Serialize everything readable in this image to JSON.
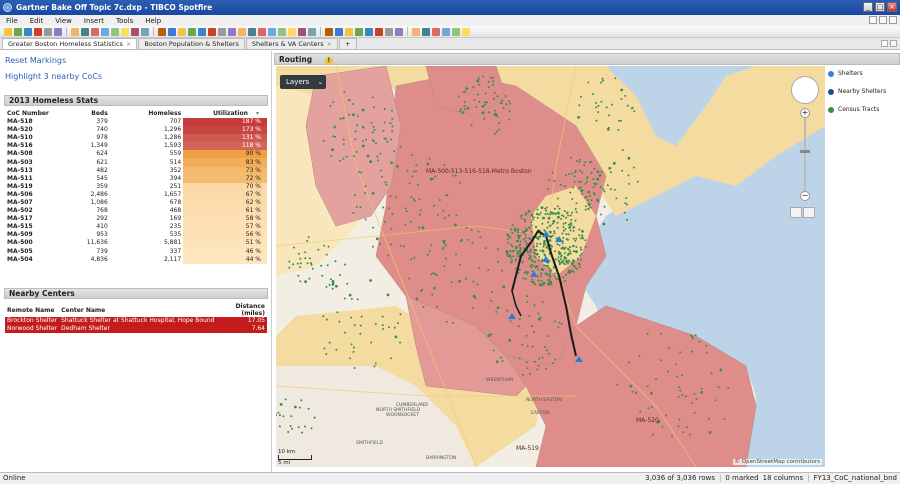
{
  "window": {
    "title": "Gartner Bake Off Topic 7c.dxp - TIBCO Spotfire"
  },
  "menu": [
    "File",
    "Edit",
    "View",
    "Insert",
    "Tools",
    "Help"
  ],
  "tabs": [
    {
      "label": "Greater Boston Homeless Statistics",
      "close": "×",
      "active": true
    },
    {
      "label": "Boston Population & Shelters",
      "close": "",
      "active": false
    },
    {
      "label": "Shelters & VA Centers",
      "close": "×",
      "active": false
    },
    {
      "label": "+",
      "close": "",
      "active": false
    }
  ],
  "left": {
    "reset_link": "Reset Markings",
    "highlight_link": "Highlight 3 nearby CoCs",
    "stats_title": "2013 Homeless Stats",
    "stats_columns": [
      "CoC Number",
      "Beds",
      "Homeless",
      "Utilization"
    ],
    "stats_sort_icon": "▾",
    "stats_rows": [
      {
        "coc": "MA-518",
        "beds": "379",
        "homeless": "707",
        "util": "187 %",
        "color": "#c63a3a",
        "text": "#fff"
      },
      {
        "coc": "MA-520",
        "beds": "740",
        "homeless": "1,296",
        "util": "173 %",
        "color": "#c84545",
        "text": "#fff"
      },
      {
        "coc": "MA-510",
        "beds": "978",
        "homeless": "1,286",
        "util": "131 %",
        "color": "#cf5a4f",
        "text": "#fff"
      },
      {
        "coc": "MA-516",
        "beds": "1,349",
        "homeless": "1,593",
        "util": "118 %",
        "color": "#d2665a",
        "text": "#fff"
      },
      {
        "coc": "MA-508",
        "beds": "624",
        "homeless": "559",
        "util": "90 %",
        "color": "#f0a143",
        "text": "#222"
      },
      {
        "coc": "MA-503",
        "beds": "621",
        "homeless": "514",
        "util": "83 %",
        "color": "#f3ac58",
        "text": "#222"
      },
      {
        "coc": "MA-513",
        "beds": "482",
        "homeless": "352",
        "util": "73 %",
        "color": "#f5b96c",
        "text": "#222"
      },
      {
        "coc": "MA-511",
        "beds": "545",
        "homeless": "394",
        "util": "72 %",
        "color": "#f5bb70",
        "text": "#222"
      },
      {
        "coc": "MA-519",
        "beds": "359",
        "homeless": "251",
        "util": "70 %",
        "color": "#fbd9a6",
        "text": "#222"
      },
      {
        "coc": "MA-506",
        "beds": "2,486",
        "homeless": "1,657",
        "util": "67 %",
        "color": "#fbdaa8",
        "text": "#222"
      },
      {
        "coc": "MA-507",
        "beds": "1,086",
        "homeless": "678",
        "util": "62 %",
        "color": "#fcdcab",
        "text": "#222"
      },
      {
        "coc": "MA-502",
        "beds": "768",
        "homeless": "468",
        "util": "61 %",
        "color": "#fcddae",
        "text": "#222"
      },
      {
        "coc": "MA-517",
        "beds": "292",
        "homeless": "169",
        "util": "58 %",
        "color": "#fddfb1",
        "text": "#222"
      },
      {
        "coc": "MA-515",
        "beds": "410",
        "homeless": "235",
        "util": "57 %",
        "color": "#fde0b3",
        "text": "#222"
      },
      {
        "coc": "MA-509",
        "beds": "953",
        "homeless": "535",
        "util": "56 %",
        "color": "#fde1b5",
        "text": "#222"
      },
      {
        "coc": "MA-500",
        "beds": "11,636",
        "homeless": "5,881",
        "util": "51 %",
        "color": "#fde3b8",
        "text": "#222"
      },
      {
        "coc": "MA-505",
        "beds": "739",
        "homeless": "337",
        "util": "46 %",
        "color": "#fde5bc",
        "text": "#222"
      },
      {
        "coc": "MA-504",
        "beds": "4,836",
        "homeless": "2,117",
        "util": "44 %",
        "color": "#fde6bf",
        "text": "#222"
      }
    ],
    "centers_title": "Nearby Centers",
    "centers_columns": [
      "Remote Name",
      "Center Name",
      "Distance (miles)"
    ],
    "centers_rows": [
      {
        "remote": "Brockton Shelter",
        "center": "Shattuck Shelter at Shattuck Hospital, Hope Bound",
        "distance": "17.05"
      },
      {
        "remote": "Norwood Shelter",
        "center": "Dedham Shelter",
        "distance": "7.64"
      }
    ]
  },
  "map": {
    "title": "Routing",
    "layers_label": "Layers",
    "zoom_in": "+",
    "zoom_out": "−",
    "labels": {
      "big_region": "MA-500-513-516-518-Metro Boston",
      "ma520": "MA-520",
      "ma519": "MA-519",
      "north_easton": "NORTH EASTON",
      "easton": "EASTON",
      "cumberland": "CUMBERLAND",
      "north_smithfield": "NORTH SMITHFIELD",
      "woonsocket": "WOONSOCKET",
      "barrington": "BARRINGTON",
      "smithfield": "SMITHFIELD",
      "wrentham": "WRENTHAM"
    },
    "scale_km": "10 km",
    "scale_mi": "5 mi",
    "attribution": "© OpenStreetMap contributors",
    "colors": {
      "red_region": "#df8d8b",
      "tan_region": "#f4dca0",
      "water": "#bcd3e8",
      "land": "#f2eee4",
      "route": "#1b1b1b",
      "shelter": "#2e7bd6"
    }
  },
  "legend": [
    {
      "label": "Shelters",
      "color": "#2e86de"
    },
    {
      "label": "Nearby Shelters",
      "color": "#1e4d8c"
    },
    {
      "label": "Census Tracts",
      "color": "#3b8e48"
    }
  ],
  "status": {
    "left": "Online",
    "rows": "3,036 of 3,036 rows",
    "marked": "0 marked",
    "columns": "18 columns",
    "table": "FY13_CoC_national_bnd"
  }
}
